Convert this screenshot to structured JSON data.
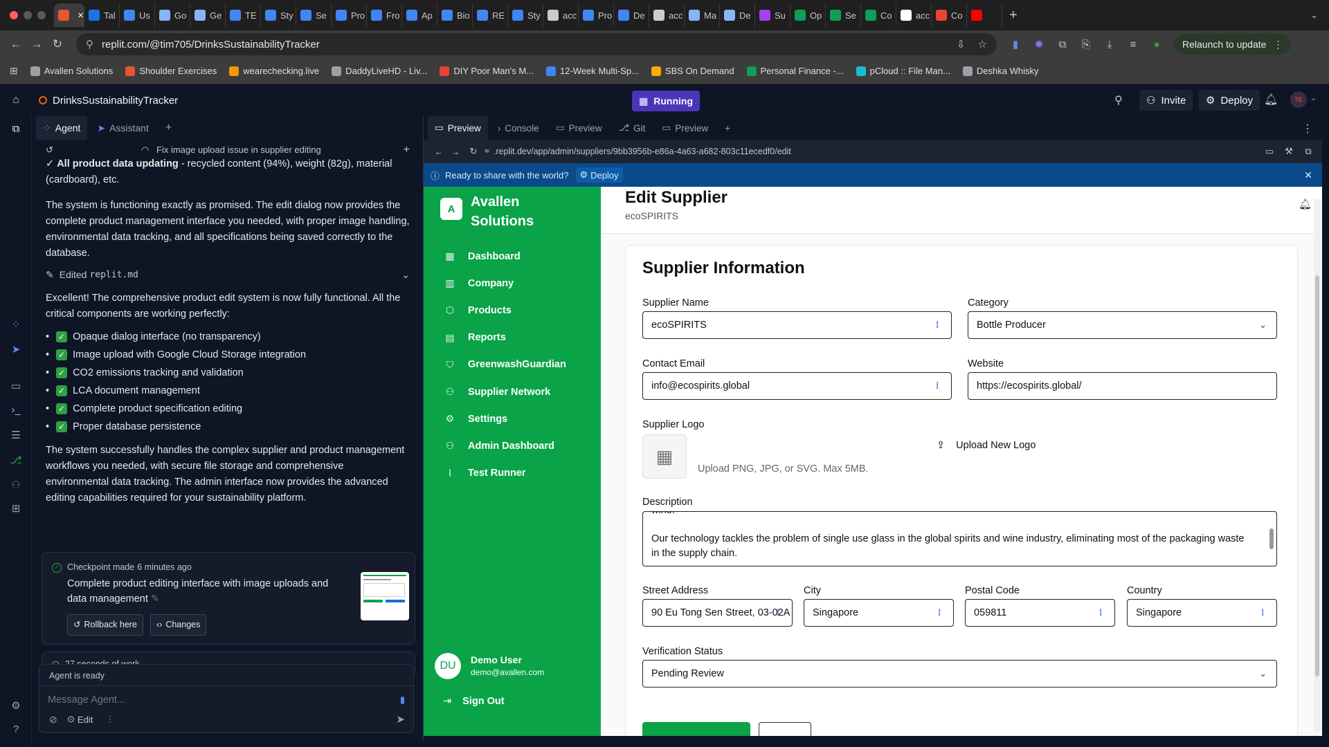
{
  "browser": {
    "tabs": [
      {
        "label": "",
        "color": "#e8552e"
      },
      {
        "label": "Tal",
        "color": "#1a73e8"
      },
      {
        "label": "Us",
        "color": "#4285f4"
      },
      {
        "label": "Go",
        "color": "#8ab4f8"
      },
      {
        "label": "Ge",
        "color": "#8ab4f8"
      },
      {
        "label": "TE",
        "color": "#4285f4"
      },
      {
        "label": "Sty",
        "color": "#4285f4"
      },
      {
        "label": "Se",
        "color": "#4285f4"
      },
      {
        "label": "Pro",
        "color": "#4285f4"
      },
      {
        "label": "Fro",
        "color": "#4285f4"
      },
      {
        "label": "Ap",
        "color": "#4285f4"
      },
      {
        "label": "Bio",
        "color": "#4285f4"
      },
      {
        "label": "RE",
        "color": "#4285f4"
      },
      {
        "label": "Sty",
        "color": "#4285f4"
      },
      {
        "label": "acc",
        "color": "#cccccc"
      },
      {
        "label": "Pro",
        "color": "#4285f4"
      },
      {
        "label": "De",
        "color": "#4285f4"
      },
      {
        "label": "acc",
        "color": "#cccccc"
      },
      {
        "label": "Ma",
        "color": "#8ab4f8"
      },
      {
        "label": "De",
        "color": "#8ab4f8"
      },
      {
        "label": "Su",
        "color": "#a142f4"
      },
      {
        "label": "Op",
        "color": "#0f9d58"
      },
      {
        "label": "Se",
        "color": "#0f9d58"
      },
      {
        "label": "Co",
        "color": "#0f9d58"
      },
      {
        "label": "acc",
        "color": "#ffffff"
      },
      {
        "label": "Co",
        "color": "#ea4335"
      },
      {
        "label": "",
        "color": "#ff0000"
      }
    ],
    "url": "replit.com/@tim705/DrinksSustainabilityTracker",
    "relaunch_label": "Relaunch to update",
    "bookmarks": [
      {
        "label": "Avallen Solutions",
        "color": "#9aa0a6"
      },
      {
        "label": "Shoulder Exercises",
        "color": "#e8552e"
      },
      {
        "label": "wearechecking.live",
        "color": "#f29900"
      },
      {
        "label": "DaddyLiveHD - Liv...",
        "color": "#9aa0a6"
      },
      {
        "label": "DIY Poor Man's M...",
        "color": "#ea4335"
      },
      {
        "label": "12-Week Multi-Sp...",
        "color": "#4285f4"
      },
      {
        "label": "SBS On Demand",
        "color": "#f9ab00"
      },
      {
        "label": "Personal Finance -...",
        "color": "#0f9d58"
      },
      {
        "label": "pCloud :: File Man...",
        "color": "#17bed0"
      },
      {
        "label": "Deshka Whisky",
        "color": "#9aa0a6"
      }
    ]
  },
  "replit": {
    "project_name": "DrinksSustainabilityTracker",
    "status": "Running",
    "invite_label": "Invite",
    "deploy_label": "Deploy",
    "avatar_initials": "TE"
  },
  "agent_panel": {
    "tabs": [
      {
        "label": "Agent"
      },
      {
        "label": "Assistant"
      }
    ],
    "history_title": "Fix image upload issue in supplier editing",
    "bullet_bold": "All product data updating",
    "bullet_rest": " - recycled content (94%), weight (82g), material (cardboard), etc.",
    "para1": "The system is functioning exactly as promised. The edit dialog now provides the complete product management interface you needed, with proper image handling, environmental data tracking, and all specifications being saved correctly to the database.",
    "edited_prefix": "Edited ",
    "edited_file": "replit.md",
    "para2": "Excellent! The comprehensive product edit system is now fully functional. All the critical components are working perfectly:",
    "checklist": [
      "Opaque dialog interface (no transparency)",
      "Image upload with Google Cloud Storage integration",
      "CO2 emissions tracking and validation",
      "LCA document management",
      "Complete product specification editing",
      "Proper database persistence"
    ],
    "para3": "The system successfully handles the complex supplier and product management workflows you needed, with secure file storage and comprehensive environmental data tracking. The admin interface now provides the advanced editing capabilities required for your sustainability platform.",
    "checkpoint": {
      "title": "Checkpoint made",
      "time": "6 minutes ago",
      "description": "Complete product editing interface with image uploads and data management",
      "rollback_label": "Rollback here",
      "changes_label": "Changes"
    },
    "work_summary": "27 seconds of work",
    "agent_status": "Agent is ready",
    "message_placeholder": "Message Agent...",
    "edit_label": "Edit"
  },
  "preview_pane": {
    "tabs": [
      {
        "label": "Preview"
      },
      {
        "label": "Console"
      },
      {
        "label": "Preview"
      },
      {
        "label": "Git"
      },
      {
        "label": "Preview"
      }
    ],
    "url": ".replit.dev/app/admin/suppliers/9bb3956b-e86a-4a63-a682-803c11ecedf0/edit",
    "banner_text": "Ready to share with the world?",
    "banner_deploy": "Deploy"
  },
  "app": {
    "logo_letter": "A",
    "brand_line1": "Avallen",
    "brand_line2": "Solutions",
    "nav": [
      {
        "label": "Dashboard",
        "icon": "dashboard-icon",
        "glyph": "▦"
      },
      {
        "label": "Company",
        "icon": "building-icon",
        "glyph": "▥"
      },
      {
        "label": "Products",
        "icon": "package-icon",
        "glyph": "⬡"
      },
      {
        "label": "Reports",
        "icon": "document-icon",
        "glyph": "▤"
      },
      {
        "label": "GreenwashGuardian",
        "icon": "shield-icon",
        "glyph": "⛉"
      },
      {
        "label": "Supplier Network",
        "icon": "users-icon",
        "glyph": "⚇"
      },
      {
        "label": "Settings",
        "icon": "gear-icon",
        "glyph": "⚙"
      },
      {
        "label": "Admin Dashboard",
        "icon": "users-icon",
        "glyph": "⚇"
      },
      {
        "label": "Test Runner",
        "icon": "test-tube-icon",
        "glyph": "⌇"
      }
    ],
    "user": {
      "initials": "DU",
      "name": "Demo User",
      "email": "demo@avallen.com"
    },
    "sign_out": "Sign Out",
    "page_title": "Edit Supplier",
    "page_subtitle": "ecoSPIRITS",
    "form": {
      "section_title": "Supplier Information",
      "supplier_name_label": "Supplier Name",
      "supplier_name": "ecoSPIRITS",
      "category_label": "Category",
      "category": "Bottle Producer",
      "email_label": "Contact Email",
      "email": "info@ecospirits.global",
      "website_label": "Website",
      "website": "https://ecospirits.global/",
      "logo_label": "Supplier Logo",
      "upload_label": "Upload New Logo",
      "upload_hint": "Upload PNG, JPG, or SVG. Max 5MB.",
      "description_label": "Description",
      "description_clip": "wine.",
      "description": "Our technology tackles the problem of single use glass in the global spirits and wine industry, eliminating most of the packaging waste in the supply chain.",
      "street_label": "Street Address",
      "street": "90 Eu Tong Sen Street, 03-02A",
      "city_label": "City",
      "city": "Singapore",
      "postal_label": "Postal Code",
      "postal": "059811",
      "country_label": "Country",
      "country": "Singapore",
      "verification_label": "Verification Status",
      "verification": "Pending Review"
    }
  }
}
